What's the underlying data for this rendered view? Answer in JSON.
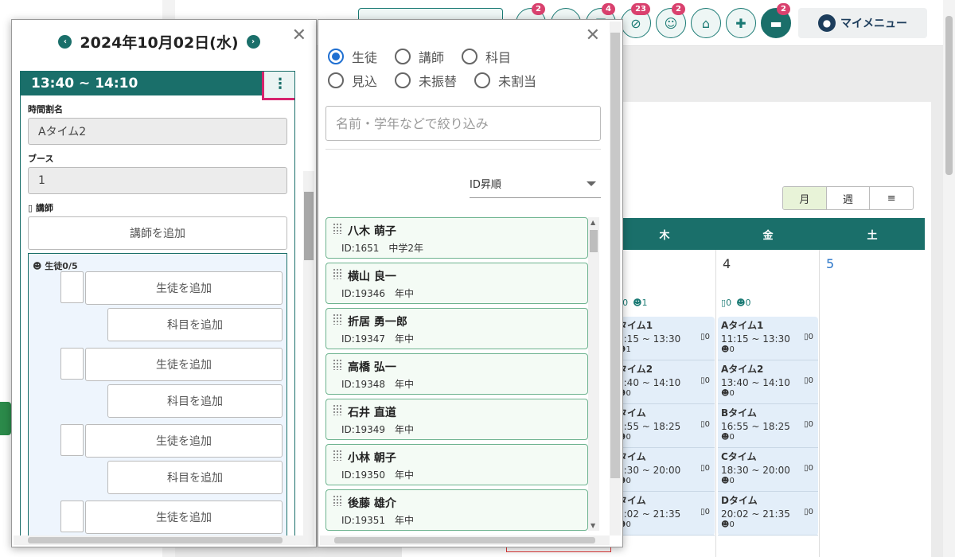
{
  "topbar": {
    "badges": [
      "2",
      "",
      "4",
      "23",
      "2",
      "",
      "",
      "2"
    ],
    "my_menu_label": "マイメニュー"
  },
  "view_switch": [
    "月",
    "週",
    "≡"
  ],
  "calendar": {
    "weekdays": [
      "木",
      "金",
      "土"
    ],
    "dates": [
      "",
      "4",
      "5"
    ],
    "counts": [
      [
        "0",
        "1"
      ],
      [
        "0",
        "0"
      ]
    ],
    "slots": [
      {
        "name": "Aタイム1",
        "time": "11:15 ~ 13:30",
        "count": "0",
        "student": "0"
      },
      {
        "name": "Aタイム2",
        "time": "13:40 ~ 14:10",
        "count": "0",
        "student": "0"
      },
      {
        "name": "Bタイム",
        "time": "16:55 ~ 18:25",
        "count": "0",
        "student": "0"
      },
      {
        "name": "Cタイム",
        "time": "18:30 ~ 20:00",
        "count": "0",
        "student": "0"
      },
      {
        "name": "Dタイム",
        "time": "20:02 ~ 21:35",
        "count": "0",
        "student": "0"
      }
    ],
    "slots_partial": [
      {
        "name": "タイム1",
        "time": "1:15 ~ 13:30",
        "count": "0",
        "student": "1"
      },
      {
        "name": "タイム2",
        "time": "3:40 ~ 14:10",
        "count": "0",
        "student": "0"
      },
      {
        "name": "タイム",
        "time": "6:55 ~ 18:25",
        "count": "0",
        "student": "0"
      },
      {
        "name": "タイム",
        "time": "8:30 ~ 20:00",
        "count": "0",
        "student": "0"
      },
      {
        "name": "タイム",
        "time": "0:02 ~ 21:35",
        "count": "0",
        "student": "0"
      }
    ]
  },
  "left_panel": {
    "date": "2024年10月02日(水)",
    "time_range": "13:40 ~ 14:10",
    "jikanwari_label": "時間割名",
    "jikanwari_value": "Aタイム2",
    "booth_label": "ブース",
    "booth_value": "1",
    "teacher_label": "講師",
    "add_teacher": "講師を追加",
    "students_label": "生徒0/5",
    "add_student": "生徒を追加",
    "add_subject": "科目を追加"
  },
  "right_panel": {
    "radios_row1": [
      "生徒",
      "講師",
      "科目"
    ],
    "radios_row2": [
      "見込",
      "未振替",
      "未割当"
    ],
    "search_placeholder": "名前・学年などで絞り込み",
    "sort_label": "ID昇順",
    "students": [
      {
        "name": "八木 萌子",
        "meta": "ID:1651　中学2年"
      },
      {
        "name": "横山 良一",
        "meta": "ID:19346　年中"
      },
      {
        "name": "折居 勇一郎",
        "meta": "ID:19347　年中"
      },
      {
        "name": "高橋 弘一",
        "meta": "ID:19348　年中"
      },
      {
        "name": "石井 直道",
        "meta": "ID:19349　年中"
      },
      {
        "name": "小林 朝子",
        "meta": "ID:19350　年中"
      },
      {
        "name": "後藤 雄介",
        "meta": "ID:19351　年中"
      }
    ]
  },
  "colors": {
    "primary": "#1a6f6a",
    "accent_pink": "#d6246e",
    "radio_blue": "#1f6fd1"
  }
}
